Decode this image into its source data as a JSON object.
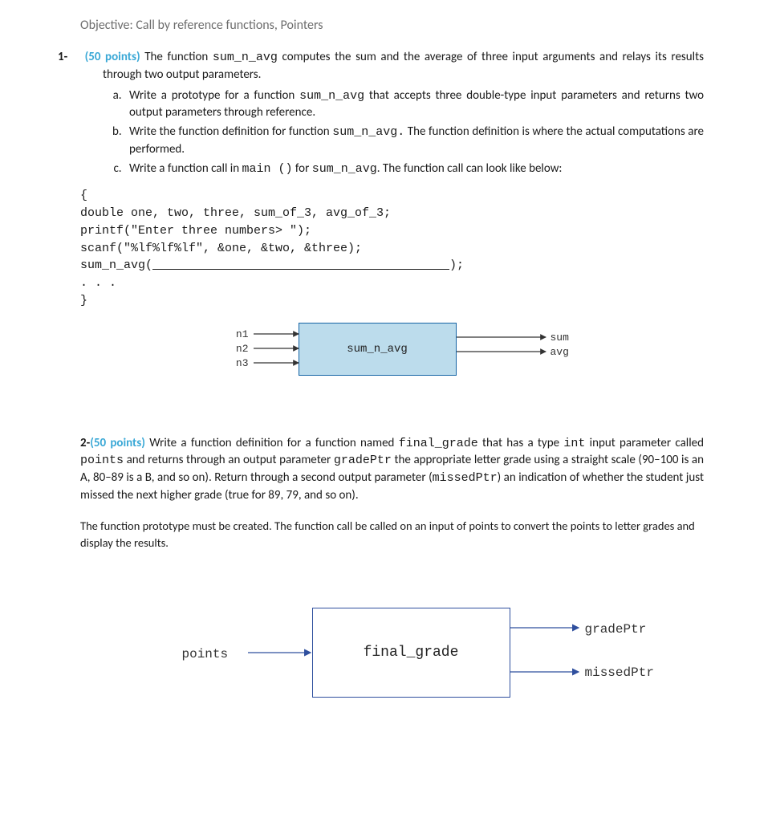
{
  "objective": "Objective: Call by reference functions, Pointers",
  "q1": {
    "num": "1- ",
    "points": "(50 points)",
    "intro_before_code": " The function ",
    "code1": "sum_n_avg",
    "intro_after_code": " computes the sum and the average of three input arguments and relays its results through two output parameters.",
    "a_before": "Write a prototype for a function ",
    "a_code": "sum_n_avg",
    "a_after": " that accepts three double-type input parameters and returns two output parameters through reference.",
    "b_before": "Write the function definition for function ",
    "b_code": "sum_n_avg.",
    "b_after": "  The function definition is where the actual computations are performed.",
    "c_before": "Write a function call in ",
    "c_code1": "main ()",
    "c_mid": " for ",
    "c_code2": "sum_n_avg",
    "c_after": ". The function call can look like below:",
    "code_line1": "{",
    "code_line2": "double one, two, three, sum_of_3, avg_of_3;",
    "code_line3": "printf(\"Enter three numbers> \");",
    "code_line4": "scanf(\"%lf%lf%lf\", &one, &two, &three);",
    "code_line5_left": "sum_n_avg(",
    "code_line5_right": ");",
    "code_line6": ". . .",
    "code_line7": "}",
    "diagram": {
      "n1": "n1",
      "n2": "n2",
      "n3": "n3",
      "box": "sum_n_avg",
      "sum": "sum",
      "avg": "avg"
    }
  },
  "q2": {
    "num": "2- ",
    "points": "(50 points)",
    "p1_a": " Write a function definition for a function named ",
    "p1_code1": "final_grade",
    "p1_b": "  that has a type ",
    "p1_code2": "int",
    "p1_c": "  input parameter called ",
    "p1_code3": "points",
    "p1_d": " and returns through an output parameter ",
    "p1_code4": "gradePtr",
    "p1_e": "  the appropriate letter grade using a straight scale (90–100 is an A, 80–89 is a B, and so on). Return through a second output parameter (",
    "p1_code5": "missedPtr",
    "p1_f": ") an indication of whether the student just missed the next higher grade (true for 89, 79, and so on).",
    "p2": "The function prototype must be created. The function call be called on an input of points to convert the points to letter grades and display the results.",
    "diagram": {
      "points": "points",
      "box": "final_grade",
      "gradePtr": "gradePtr",
      "missedPtr": "missedPtr"
    }
  }
}
